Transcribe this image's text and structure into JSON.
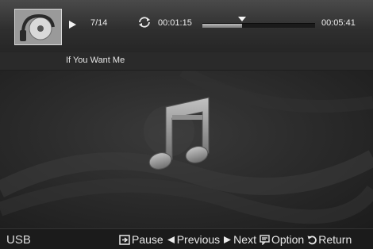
{
  "player": {
    "track_counter": "7/14",
    "current_time": "00:01:15",
    "total_time": "00:05:41",
    "progress_fraction": 0.35
  },
  "song": {
    "title": "If You Want Me"
  },
  "footer": {
    "source": "USB",
    "controls": [
      {
        "key": "pause",
        "label": "Pause",
        "icon": "enter-icon"
      },
      {
        "key": "previous",
        "label": "Previous",
        "icon": "triangle-left-icon"
      },
      {
        "key": "next",
        "label": "Next",
        "icon": "triangle-right-icon"
      },
      {
        "key": "option",
        "label": "Option",
        "icon": "tools-icon"
      },
      {
        "key": "return",
        "label": "Return",
        "icon": "return-arrow-icon"
      }
    ]
  },
  "colors": {
    "top_bar": "#3a3a3a",
    "main_bg": "#2c2c2c",
    "bottom_bar": "#1b1b1b",
    "note": "#9a9a9a"
  }
}
